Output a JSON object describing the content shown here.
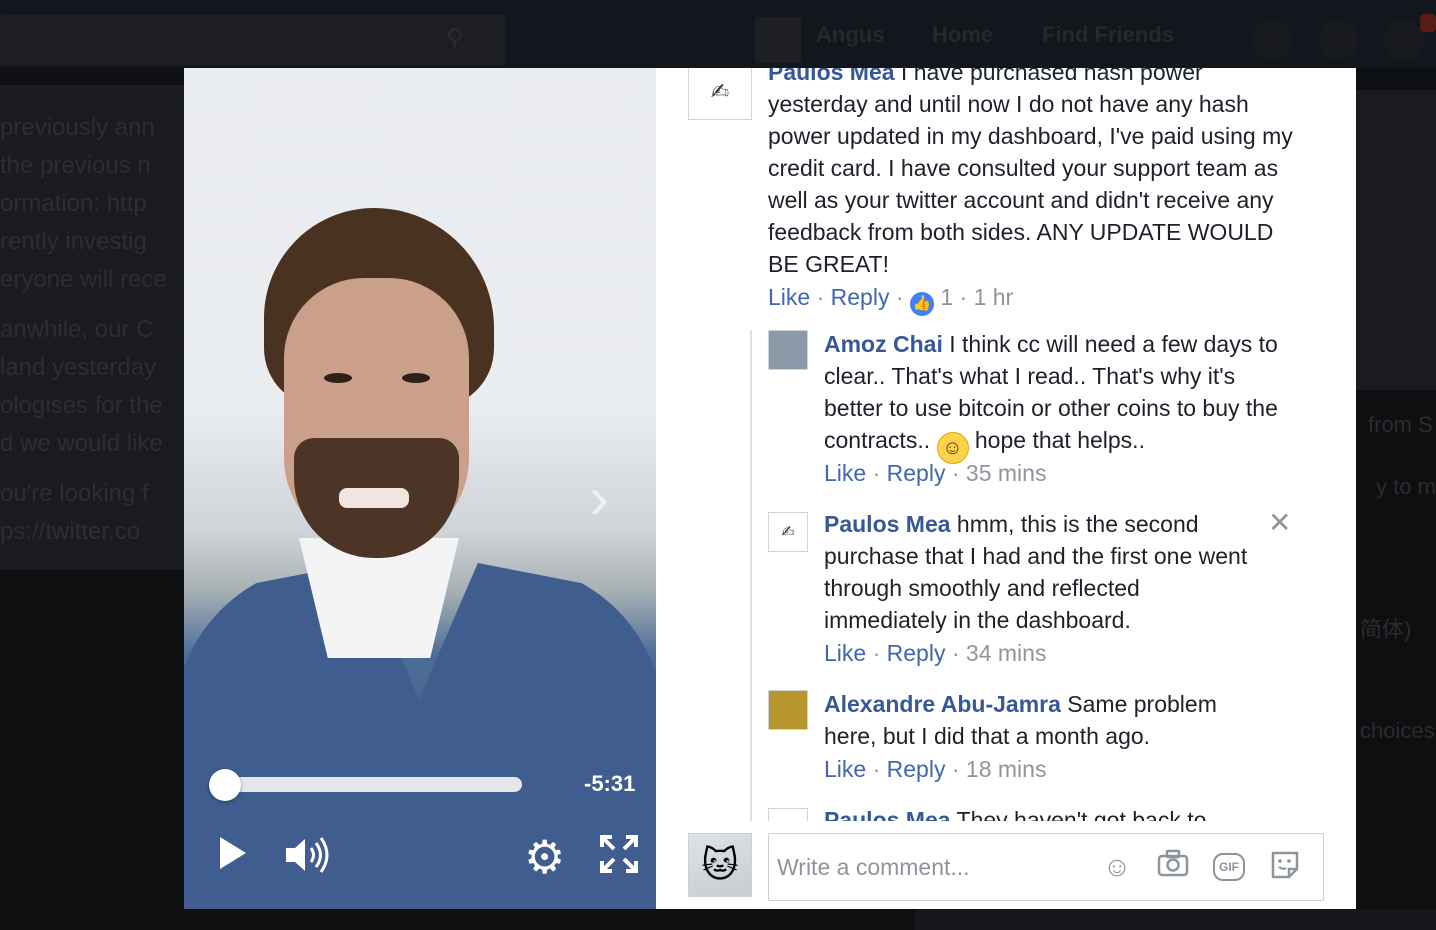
{
  "background": {
    "user_name": "Angus",
    "nav_home": "Home",
    "nav_find_friends": "Find Friends",
    "post_lines": [
      "previously ann",
      "the previous n",
      "ormation: http",
      "rently investig",
      "eryone will rece",
      "anwhile, our C",
      "land yesterday",
      "ologises for the",
      "d we would like",
      "ou're looking f",
      "ps://twitter.co"
    ],
    "right_lines": [
      "from S",
      "y to me",
      "简体)",
      "choices"
    ]
  },
  "video": {
    "time_remaining": "-5:31",
    "progress": 0.0
  },
  "comments": [
    {
      "author": "Paulos Mea",
      "text": " I have purchased hash power yesterday and until now I do not have any hash power updated in my dashboard, I've paid using my credit card. I have consulted your support team as well as your twitter account and didn't receive any feedback from both sides. ANY UPDATE WOULD BE GREAT!",
      "like": "Like",
      "reply": "Reply",
      "reactions": "1",
      "time": "1 hr"
    },
    {
      "author": "Amoz Chai",
      "text_before": " I think cc will need a few days to clear.. That's what I read.. That's why it's better to use bitcoin or other coins to buy the contracts..",
      "text_after": " hope that helps..",
      "like": "Like",
      "reply": "Reply",
      "time": "35 mins"
    },
    {
      "author": "Paulos Mea",
      "text": " hmm, this is the second purchase that I had and the first one went through smoothly and reflected immediately in the dashboard.",
      "like": "Like",
      "reply": "Reply",
      "time": "34 mins"
    },
    {
      "author": "Alexandre Abu-Jamra",
      "text": " Same problem here, but I did that a month ago.",
      "like": "Like",
      "reply": "Reply",
      "time": "18 mins"
    },
    {
      "author": "Paulos Mea",
      "text": " They haven't got back to"
    }
  ],
  "composer": {
    "placeholder": "Write a comment...",
    "icons": [
      "emoji-icon",
      "camera-icon",
      "gif-icon",
      "sticker-icon"
    ],
    "gif_label": "GIF"
  },
  "colors": {
    "author_link": "#365899",
    "action_link": "#4267b2",
    "meta_gray": "#90949c",
    "like_badge": "#4080ff"
  }
}
